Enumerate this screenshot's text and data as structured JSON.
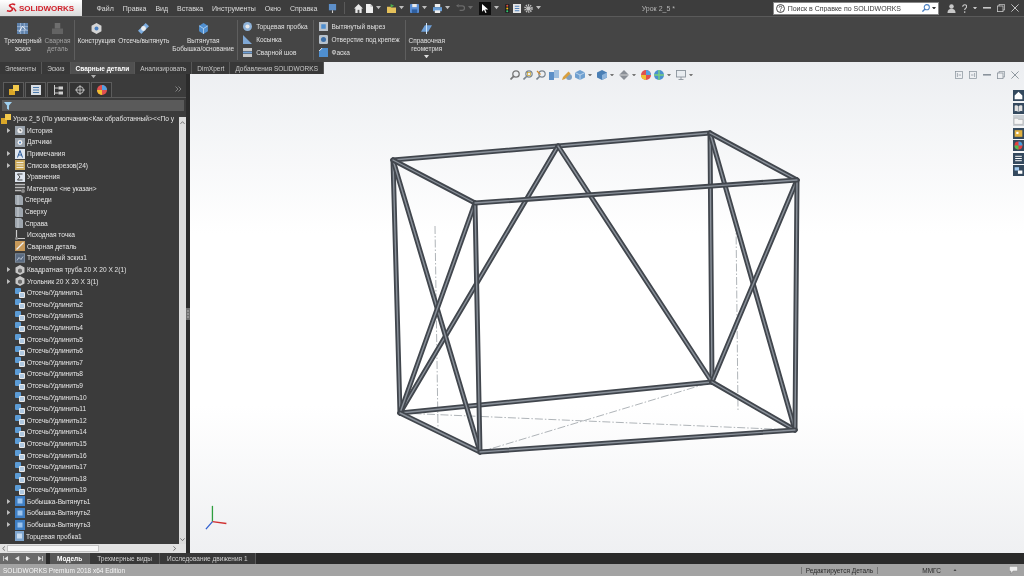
{
  "title_bar": {
    "logo": "SOLIDWORKS",
    "menu": [
      "Файл",
      "Правка",
      "Вид",
      "Вставка",
      "Инструменты",
      "Окно",
      "Справка"
    ],
    "quick_toolbar": [
      {
        "disabled": false,
        "selected": false
      },
      {
        "disabled": false,
        "selected": false
      },
      {
        "disabled": false,
        "selected": false
      },
      {
        "disabled": false,
        "selected": false
      },
      {
        "disabled": false,
        "selected": false
      },
      {
        "disabled": false,
        "selected": false
      },
      {
        "disabled": true,
        "selected": false
      },
      {
        "disabled": false,
        "selected": true
      },
      {
        "disabled": false,
        "selected": false
      },
      {
        "disabled": false,
        "selected": false
      },
      {
        "disabled": false,
        "selected": false
      }
    ],
    "document_title": "Урок 2_5 *",
    "search": {
      "placeholder": "Поиск в Справке по SOLIDWORKS"
    }
  },
  "ribbon": {
    "groups": [
      {
        "kind": "large",
        "items": [
          {
            "label": "Трехмерный эскиз",
            "disabled": false
          },
          {
            "label": "Сварная деталь",
            "disabled": true
          }
        ]
      },
      {
        "kind": "large",
        "items": [
          {
            "label": "Конструкция",
            "disabled": false
          },
          {
            "label": "Отсечь/вытянуть",
            "disabled": false
          },
          {
            "label": "Вытянутая Бобышка/основание",
            "disabled": false
          }
        ]
      },
      {
        "kind": "small",
        "items": [
          {
            "label": "Торцевая пробка",
            "disabled": false
          },
          {
            "label": "Косынка",
            "disabled": false
          },
          {
            "label": "Сварной шов",
            "disabled": false
          }
        ]
      },
      {
        "kind": "small",
        "items": [
          {
            "label": "Вытянутый вырез",
            "disabled": false
          },
          {
            "label": "Отверстие под крепеж",
            "disabled": false
          },
          {
            "label": "Фаска",
            "disabled": false
          }
        ]
      },
      {
        "kind": "large",
        "items": [
          {
            "label": "Справочная геометрия",
            "disabled": false,
            "dropdown": true
          }
        ]
      }
    ]
  },
  "command_tabs": [
    {
      "label": "Элементы",
      "selected": false
    },
    {
      "label": "Эскиз",
      "selected": false
    },
    {
      "label": "Сварные детали",
      "selected": true
    },
    {
      "label": "Анализировать",
      "selected": false
    },
    {
      "label": "DimXpert",
      "selected": false
    },
    {
      "label": "Добавления SOLIDWORKS",
      "selected": false
    }
  ],
  "feature_tree": {
    "root": {
      "label": "Урок 2_5  (По умолчанию<Как обработанный><<По у",
      "kind": "part",
      "children": [
        {
          "label": "История",
          "kind": "history",
          "expanded": false
        },
        {
          "label": "Датчики",
          "kind": "sensors"
        },
        {
          "label": "Примечания",
          "kind": "annotations",
          "expanded": false
        },
        {
          "label": "Список вырезов(24)",
          "kind": "cut-list",
          "expanded": false
        },
        {
          "label": "Уравнения",
          "kind": "equations"
        },
        {
          "label": "Материал <не указан>",
          "kind": "material"
        },
        {
          "label": "Спереди",
          "kind": "plane"
        },
        {
          "label": "Сверху",
          "kind": "plane"
        },
        {
          "label": "Справа",
          "kind": "plane"
        },
        {
          "label": "Исходная точка",
          "kind": "origin"
        },
        {
          "label": "Сварная деталь",
          "kind": "weldment"
        },
        {
          "label": "Трехмерный эскиз1",
          "kind": "sketch"
        },
        {
          "label": "Квадратная труба 20 X 20 X 2(1)",
          "kind": "structural-member",
          "expanded": false
        },
        {
          "label": "Угольник 20 X 20 X 3(1)",
          "kind": "structural-member",
          "expanded": false
        },
        {
          "label": "Отсечь/Удлинить1",
          "kind": "trim"
        },
        {
          "label": "Отсечь/Удлинить2",
          "kind": "trim"
        },
        {
          "label": "Отсечь/Удлинить3",
          "kind": "trim"
        },
        {
          "label": "Отсечь/Удлинить4",
          "kind": "trim"
        },
        {
          "label": "Отсечь/Удлинить5",
          "kind": "trim"
        },
        {
          "label": "Отсечь/Удлинить6",
          "kind": "trim"
        },
        {
          "label": "Отсечь/Удлинить7",
          "kind": "trim"
        },
        {
          "label": "Отсечь/Удлинить8",
          "kind": "trim"
        },
        {
          "label": "Отсечь/Удлинить9",
          "kind": "trim"
        },
        {
          "label": "Отсечь/Удлинить10",
          "kind": "trim"
        },
        {
          "label": "Отсечь/Удлинить11",
          "kind": "trim"
        },
        {
          "label": "Отсечь/Удлинить12",
          "kind": "trim"
        },
        {
          "label": "Отсечь/Удлинить14",
          "kind": "trim"
        },
        {
          "label": "Отсечь/Удлинить15",
          "kind": "trim"
        },
        {
          "label": "Отсечь/Удлинить16",
          "kind": "trim"
        },
        {
          "label": "Отсечь/Удлинить17",
          "kind": "trim"
        },
        {
          "label": "Отсечь/Удлинить18",
          "kind": "trim"
        },
        {
          "label": "Отсечь/Удлинить19",
          "kind": "trim"
        },
        {
          "label": "Бобышка-Вытянуть1",
          "kind": "boss-extrude",
          "expanded": false
        },
        {
          "label": "Бобышка-Вытянуть2",
          "kind": "boss-extrude",
          "expanded": false
        },
        {
          "label": "Бобышка-Вытянуть3",
          "kind": "boss-extrude",
          "expanded": false
        },
        {
          "label": "Торцевая пробка1",
          "kind": "end-cap"
        }
      ]
    }
  },
  "bottom_tabs": [
    {
      "label": "Модель",
      "selected": true
    },
    {
      "label": "Трехмерные виды",
      "selected": false
    },
    {
      "label": "Исследование движения 1",
      "selected": false
    }
  ],
  "status_bar": {
    "product": "SOLIDWORKS Premium 2018 x64 Edition",
    "mode": "Редактируется Деталь",
    "units": "ММГС"
  }
}
